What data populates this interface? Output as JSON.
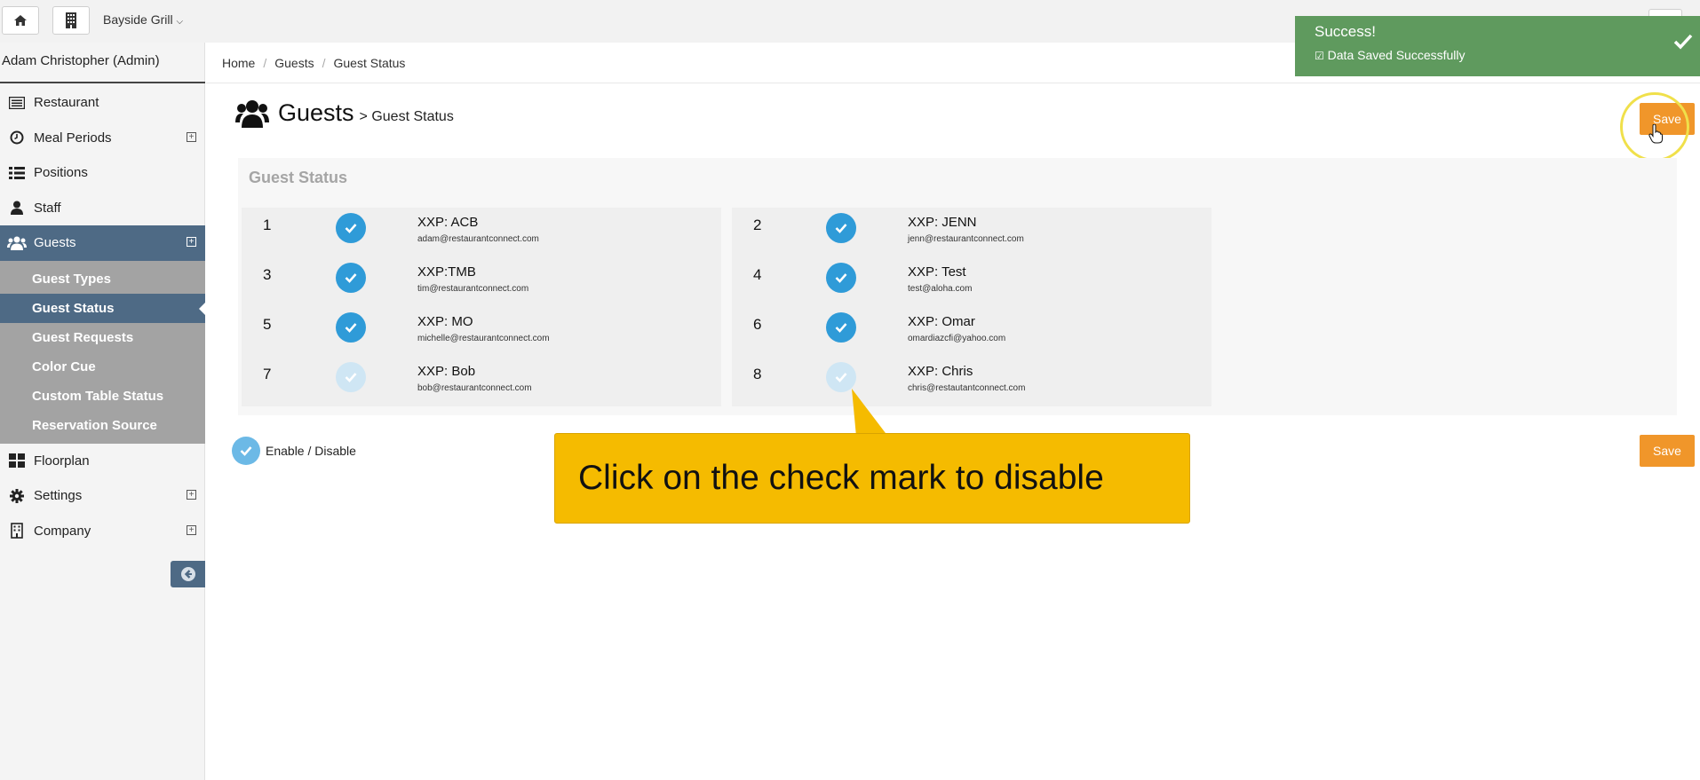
{
  "topbar": {
    "restaurant_selector": "Bayside Grill"
  },
  "sidebar": {
    "user": "Adam Christopher (Admin)",
    "items": [
      {
        "label": "Restaurant",
        "icon": "list-icon",
        "expandable": false
      },
      {
        "label": "Meal Periods",
        "icon": "clock-icon",
        "expandable": true
      },
      {
        "label": "Positions",
        "icon": "list-bullets-icon",
        "expandable": false
      },
      {
        "label": "Staff",
        "icon": "user-icon",
        "expandable": false
      },
      {
        "label": "Guests",
        "icon": "users-icon",
        "expandable": true,
        "active": true
      }
    ],
    "guest_subitems": [
      {
        "label": "Guest Types"
      },
      {
        "label": "Guest Status",
        "active": true
      },
      {
        "label": "Guest Requests"
      },
      {
        "label": "Color Cue"
      },
      {
        "label": "Custom Table Status"
      },
      {
        "label": "Reservation Source"
      }
    ],
    "items_after": [
      {
        "label": "Floorplan",
        "icon": "grid-icon",
        "expandable": false
      },
      {
        "label": "Settings",
        "icon": "gear-icon",
        "expandable": true
      },
      {
        "label": "Company",
        "icon": "building-icon",
        "expandable": true
      }
    ]
  },
  "breadcrumb": {
    "home": "Home",
    "guests": "Guests",
    "current": "Guest Status",
    "separator": "/"
  },
  "page": {
    "title": "Guests",
    "subtitle": "> Guest Status",
    "save_label": "Save",
    "panel_title": "Guest Status"
  },
  "guests": [
    {
      "num": "1",
      "name": "XXP: ACB",
      "email": "adam@restaurantconnect.com",
      "enabled": true
    },
    {
      "num": "2",
      "name": "XXP: JENN",
      "email": "jenn@restaurantconnect.com",
      "enabled": true
    },
    {
      "num": "3",
      "name": "XXP:TMB",
      "email": "tim@restaurantconnect.com",
      "enabled": true
    },
    {
      "num": "4",
      "name": "XXP: Test",
      "email": "test@aloha.com",
      "enabled": true
    },
    {
      "num": "5",
      "name": "XXP: MO",
      "email": "michelle@restaurantconnect.com",
      "enabled": true
    },
    {
      "num": "6",
      "name": "XXP: Omar",
      "email": "omardiazcfi@yahoo.com",
      "enabled": true
    },
    {
      "num": "7",
      "name": "XXP: Bob",
      "email": "bob@restaurantconnect.com",
      "enabled": false
    },
    {
      "num": "8",
      "name": "XXP: Chris",
      "email": "chris@restautantconnect.com",
      "enabled": false
    }
  ],
  "legend": {
    "label": "Enable / Disable"
  },
  "callout": {
    "text": "Click on the check mark to disable"
  },
  "toast": {
    "title": "Success!",
    "message": "Data Saved Successfully"
  },
  "colors": {
    "accent_blue": "#2f9bd8",
    "save_orange": "#f0962a",
    "toast_green": "#5f9a5e",
    "callout_yellow": "#f5bb00",
    "nav_active": "#4e6a85"
  }
}
